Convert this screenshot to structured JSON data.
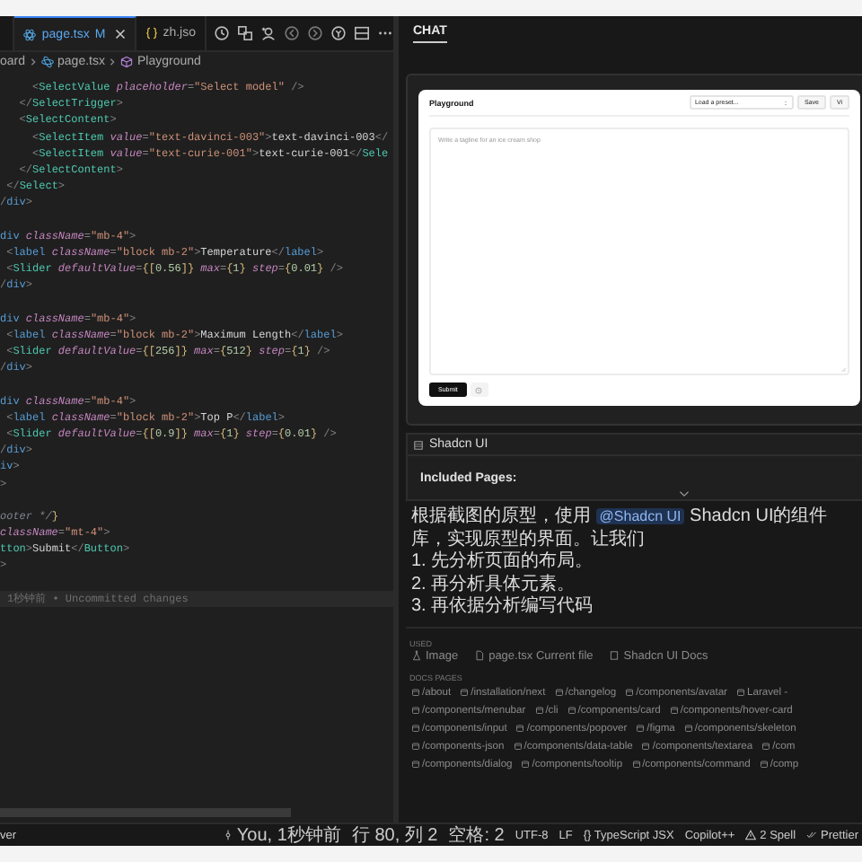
{
  "editor": {
    "tabs": [
      {
        "label": "page.tsx",
        "badge": "M",
        "selected": true,
        "kind": "react"
      },
      {
        "label": "zh.jso",
        "selected": false,
        "kind": "json"
      }
    ],
    "breadcrumb": [
      "oard",
      "page.tsx",
      "Playground"
    ],
    "lines": [
      {
        "kind": "code",
        "tokens": [
          {
            "kind": "punct",
            "text": "     <"
          },
          {
            "kind": "comp",
            "text": "SelectValue"
          },
          {
            "kind": "attr",
            "text": " placeholder"
          },
          {
            "kind": "punct",
            "text": "="
          },
          {
            "kind": "str",
            "text": "\"Select model\""
          },
          {
            "kind": "punct",
            "text": " />"
          }
        ]
      },
      {
        "kind": "code",
        "tokens": [
          {
            "kind": "punct",
            "text": "   </"
          },
          {
            "kind": "comp",
            "text": "SelectTrigger"
          },
          {
            "kind": "punct",
            "text": ">"
          }
        ]
      },
      {
        "kind": "code",
        "tokens": [
          {
            "kind": "punct",
            "text": "   <"
          },
          {
            "kind": "comp",
            "text": "SelectContent"
          },
          {
            "kind": "punct",
            "text": ">"
          }
        ]
      },
      {
        "kind": "code",
        "tokens": [
          {
            "kind": "punct",
            "text": "     <"
          },
          {
            "kind": "comp",
            "text": "SelectItem"
          },
          {
            "kind": "attr",
            "text": " value"
          },
          {
            "kind": "punct",
            "text": "="
          },
          {
            "kind": "str",
            "text": "\"text-davinci-003\""
          },
          {
            "kind": "punct",
            "text": ">"
          },
          {
            "kind": "text",
            "text": "text-davinci-003"
          },
          {
            "kind": "punct",
            "text": "</"
          }
        ]
      },
      {
        "kind": "code",
        "tokens": [
          {
            "kind": "punct",
            "text": "     <"
          },
          {
            "kind": "comp",
            "text": "SelectItem"
          },
          {
            "kind": "attr",
            "text": " value"
          },
          {
            "kind": "punct",
            "text": "="
          },
          {
            "kind": "str",
            "text": "\"text-curie-001\""
          },
          {
            "kind": "punct",
            "text": ">"
          },
          {
            "kind": "text",
            "text": "text-curie-001"
          },
          {
            "kind": "punct",
            "text": "</"
          },
          {
            "kind": "comp",
            "text": "Sele"
          }
        ]
      },
      {
        "kind": "code",
        "tokens": [
          {
            "kind": "punct",
            "text": "   </"
          },
          {
            "kind": "comp",
            "text": "SelectContent"
          },
          {
            "kind": "punct",
            "text": ">"
          }
        ]
      },
      {
        "kind": "code",
        "tokens": [
          {
            "kind": "punct",
            "text": " </"
          },
          {
            "kind": "comp",
            "text": "Select"
          },
          {
            "kind": "punct",
            "text": ">"
          }
        ]
      },
      {
        "kind": "code",
        "tokens": [
          {
            "kind": "punct",
            "text": "/"
          },
          {
            "kind": "tag",
            "text": "div"
          },
          {
            "kind": "punct",
            "text": ">"
          }
        ]
      },
      {
        "kind": "blank"
      },
      {
        "kind": "code",
        "tokens": [
          {
            "kind": "tag",
            "text": "div"
          },
          {
            "kind": "attr",
            "text": " className"
          },
          {
            "kind": "punct",
            "text": "="
          },
          {
            "kind": "str",
            "text": "\"mb-4\""
          },
          {
            "kind": "punct",
            "text": ">"
          }
        ]
      },
      {
        "kind": "code",
        "tokens": [
          {
            "kind": "punct",
            "text": " <"
          },
          {
            "kind": "tag",
            "text": "label"
          },
          {
            "kind": "attr",
            "text": " className"
          },
          {
            "kind": "punct",
            "text": "="
          },
          {
            "kind": "str",
            "text": "\"block mb-2\""
          },
          {
            "kind": "punct",
            "text": ">"
          },
          {
            "kind": "text",
            "text": "Temperature"
          },
          {
            "kind": "punct",
            "text": "</"
          },
          {
            "kind": "tag",
            "text": "label"
          },
          {
            "kind": "punct",
            "text": ">"
          }
        ]
      },
      {
        "kind": "code",
        "tokens": [
          {
            "kind": "punct",
            "text": " <"
          },
          {
            "kind": "comp",
            "text": "Slider"
          },
          {
            "kind": "attr",
            "text": " defaultValue"
          },
          {
            "kind": "punct",
            "text": "="
          },
          {
            "kind": "brace",
            "text": "{["
          },
          {
            "kind": "num",
            "text": "0.56"
          },
          {
            "kind": "brace",
            "text": "]}"
          },
          {
            "kind": "attr",
            "text": " max"
          },
          {
            "kind": "punct",
            "text": "="
          },
          {
            "kind": "brace",
            "text": "{"
          },
          {
            "kind": "num",
            "text": "1"
          },
          {
            "kind": "brace",
            "text": "}"
          },
          {
            "kind": "attr",
            "text": " step"
          },
          {
            "kind": "punct",
            "text": "="
          },
          {
            "kind": "brace",
            "text": "{"
          },
          {
            "kind": "num",
            "text": "0.01"
          },
          {
            "kind": "brace",
            "text": "}"
          },
          {
            "kind": "punct",
            "text": " />"
          }
        ]
      },
      {
        "kind": "code",
        "tokens": [
          {
            "kind": "punct",
            "text": "/"
          },
          {
            "kind": "tag",
            "text": "div"
          },
          {
            "kind": "punct",
            "text": ">"
          }
        ]
      },
      {
        "kind": "blank"
      },
      {
        "kind": "code",
        "tokens": [
          {
            "kind": "tag",
            "text": "div"
          },
          {
            "kind": "attr",
            "text": " className"
          },
          {
            "kind": "punct",
            "text": "="
          },
          {
            "kind": "str",
            "text": "\"mb-4\""
          },
          {
            "kind": "punct",
            "text": ">"
          }
        ]
      },
      {
        "kind": "code",
        "tokens": [
          {
            "kind": "punct",
            "text": " <"
          },
          {
            "kind": "tag",
            "text": "label"
          },
          {
            "kind": "attr",
            "text": " className"
          },
          {
            "kind": "punct",
            "text": "="
          },
          {
            "kind": "str",
            "text": "\"block mb-2\""
          },
          {
            "kind": "punct",
            "text": ">"
          },
          {
            "kind": "text",
            "text": "Maximum Length"
          },
          {
            "kind": "punct",
            "text": "</"
          },
          {
            "kind": "tag",
            "text": "label"
          },
          {
            "kind": "punct",
            "text": ">"
          }
        ]
      },
      {
        "kind": "code",
        "tokens": [
          {
            "kind": "punct",
            "text": " <"
          },
          {
            "kind": "comp",
            "text": "Slider"
          },
          {
            "kind": "attr",
            "text": " defaultValue"
          },
          {
            "kind": "punct",
            "text": "="
          },
          {
            "kind": "brace",
            "text": "{["
          },
          {
            "kind": "num",
            "text": "256"
          },
          {
            "kind": "brace",
            "text": "]}"
          },
          {
            "kind": "attr",
            "text": " max"
          },
          {
            "kind": "punct",
            "text": "="
          },
          {
            "kind": "brace",
            "text": "{"
          },
          {
            "kind": "num",
            "text": "512"
          },
          {
            "kind": "brace",
            "text": "}"
          },
          {
            "kind": "attr",
            "text": " step"
          },
          {
            "kind": "punct",
            "text": "="
          },
          {
            "kind": "brace",
            "text": "{"
          },
          {
            "kind": "num",
            "text": "1"
          },
          {
            "kind": "brace",
            "text": "}"
          },
          {
            "kind": "punct",
            "text": " />"
          }
        ]
      },
      {
        "kind": "code",
        "tokens": [
          {
            "kind": "punct",
            "text": "/"
          },
          {
            "kind": "tag",
            "text": "div"
          },
          {
            "kind": "punct",
            "text": ">"
          }
        ]
      },
      {
        "kind": "blank"
      },
      {
        "kind": "code",
        "tokens": [
          {
            "kind": "tag",
            "text": "div"
          },
          {
            "kind": "attr",
            "text": " className"
          },
          {
            "kind": "punct",
            "text": "="
          },
          {
            "kind": "str",
            "text": "\"mb-4\""
          },
          {
            "kind": "punct",
            "text": ">"
          }
        ]
      },
      {
        "kind": "code",
        "tokens": [
          {
            "kind": "punct",
            "text": " <"
          },
          {
            "kind": "tag",
            "text": "label"
          },
          {
            "kind": "attr",
            "text": " className"
          },
          {
            "kind": "punct",
            "text": "="
          },
          {
            "kind": "str",
            "text": "\"block mb-2\""
          },
          {
            "kind": "punct",
            "text": ">"
          },
          {
            "kind": "text",
            "text": "Top P"
          },
          {
            "kind": "punct",
            "text": "</"
          },
          {
            "kind": "tag",
            "text": "label"
          },
          {
            "kind": "punct",
            "text": ">"
          }
        ]
      },
      {
        "kind": "code",
        "tokens": [
          {
            "kind": "punct",
            "text": " <"
          },
          {
            "kind": "comp",
            "text": "Slider"
          },
          {
            "kind": "attr",
            "text": " defaultValue"
          },
          {
            "kind": "punct",
            "text": "="
          },
          {
            "kind": "brace",
            "text": "{["
          },
          {
            "kind": "num",
            "text": "0.9"
          },
          {
            "kind": "brace",
            "text": "]}"
          },
          {
            "kind": "attr",
            "text": " max"
          },
          {
            "kind": "punct",
            "text": "="
          },
          {
            "kind": "brace",
            "text": "{"
          },
          {
            "kind": "num",
            "text": "1"
          },
          {
            "kind": "brace",
            "text": "}"
          },
          {
            "kind": "attr",
            "text": " step"
          },
          {
            "kind": "punct",
            "text": "="
          },
          {
            "kind": "brace",
            "text": "{"
          },
          {
            "kind": "num",
            "text": "0.01"
          },
          {
            "kind": "brace",
            "text": "}"
          },
          {
            "kind": "punct",
            "text": " />"
          }
        ]
      },
      {
        "kind": "code",
        "tokens": [
          {
            "kind": "punct",
            "text": "/"
          },
          {
            "kind": "tag",
            "text": "div"
          },
          {
            "kind": "punct",
            "text": ">"
          }
        ]
      },
      {
        "kind": "code",
        "tokens": [
          {
            "kind": "tag",
            "text": "iv"
          },
          {
            "kind": "punct",
            "text": ">"
          }
        ]
      },
      {
        "kind": "code",
        "tokens": [
          {
            "kind": "punct",
            "text": ">"
          }
        ]
      },
      {
        "kind": "blank"
      },
      {
        "kind": "code",
        "tokens": [
          {
            "kind": "comment",
            "text": "ooter */"
          },
          {
            "kind": "brace",
            "text": "}"
          }
        ]
      },
      {
        "kind": "code",
        "tokens": [
          {
            "kind": "attr",
            "text": "className"
          },
          {
            "kind": "punct",
            "text": "="
          },
          {
            "kind": "str",
            "text": "\"mt-4\""
          },
          {
            "kind": "punct",
            "text": ">"
          }
        ]
      },
      {
        "kind": "code",
        "tokens": [
          {
            "kind": "comp",
            "text": "tton"
          },
          {
            "kind": "punct",
            "text": ">"
          },
          {
            "kind": "text",
            "text": "Submit"
          },
          {
            "kind": "punct",
            "text": "</"
          },
          {
            "kind": "comp",
            "text": "Button"
          },
          {
            "kind": "punct",
            "text": ">"
          }
        ]
      },
      {
        "kind": "code",
        "tokens": [
          {
            "kind": "punct",
            "text": ">"
          }
        ]
      },
      {
        "kind": "blank"
      },
      {
        "kind": "blame",
        "text": "1秒钟前 • Uncommitted changes"
      }
    ]
  },
  "chat": {
    "tab": "CHAT",
    "attachment": {
      "title": "Playground",
      "preset": "Load a preset...",
      "buttons": [
        "Save",
        "Vi"
      ],
      "placeholder": "Write a tagline for an ice cream shop",
      "submit": "Submit"
    },
    "context": {
      "title": "Shadcn UI",
      "heading": "Included Pages:"
    },
    "message": {
      "intro": "根据截图的原型，使用",
      "mention": "@Shadcn UI",
      "rest": "Shadcn UI的组件库，实现原型的界面。让我们",
      "steps": [
        "1. 先分析页面的布局。",
        "2. 再分析具体元素。",
        "3. 再依据分析编写代码"
      ]
    },
    "used": {
      "label": "USED",
      "items": [
        {
          "label": "Image",
          "kind": "image"
        },
        {
          "label": "page.tsx",
          "note": "Current file",
          "kind": "file"
        },
        {
          "label": "Shadcn UI Docs",
          "kind": "docs"
        }
      ]
    },
    "docs": {
      "label": "DOCS PAGES",
      "rows": [
        [
          "/about",
          "/installation/next",
          "/changelog",
          "/components/avatar",
          "Laravel -"
        ],
        [
          "/components/menubar",
          "/cli",
          "/components/card",
          "/components/hover-card"
        ],
        [
          "/components/input",
          "/components/popover",
          "/figma",
          "/components/skeleton"
        ],
        [
          "/components-json",
          "/components/data-table",
          "/components/textarea",
          "/com"
        ],
        [
          "/components/dialog",
          "/components/tooltip",
          "/components/command",
          "/comp"
        ]
      ]
    }
  },
  "status_bar": {
    "left": "ver",
    "blame": "You, 1秒钟前",
    "position": "行 80, 列 2",
    "indent": "空格: 2",
    "encoding": "UTF-8",
    "eol": "LF",
    "language": "{} TypeScript JSX",
    "copilot": "Copilot++",
    "spell": "2 Spell",
    "prettier": "Prettier"
  }
}
